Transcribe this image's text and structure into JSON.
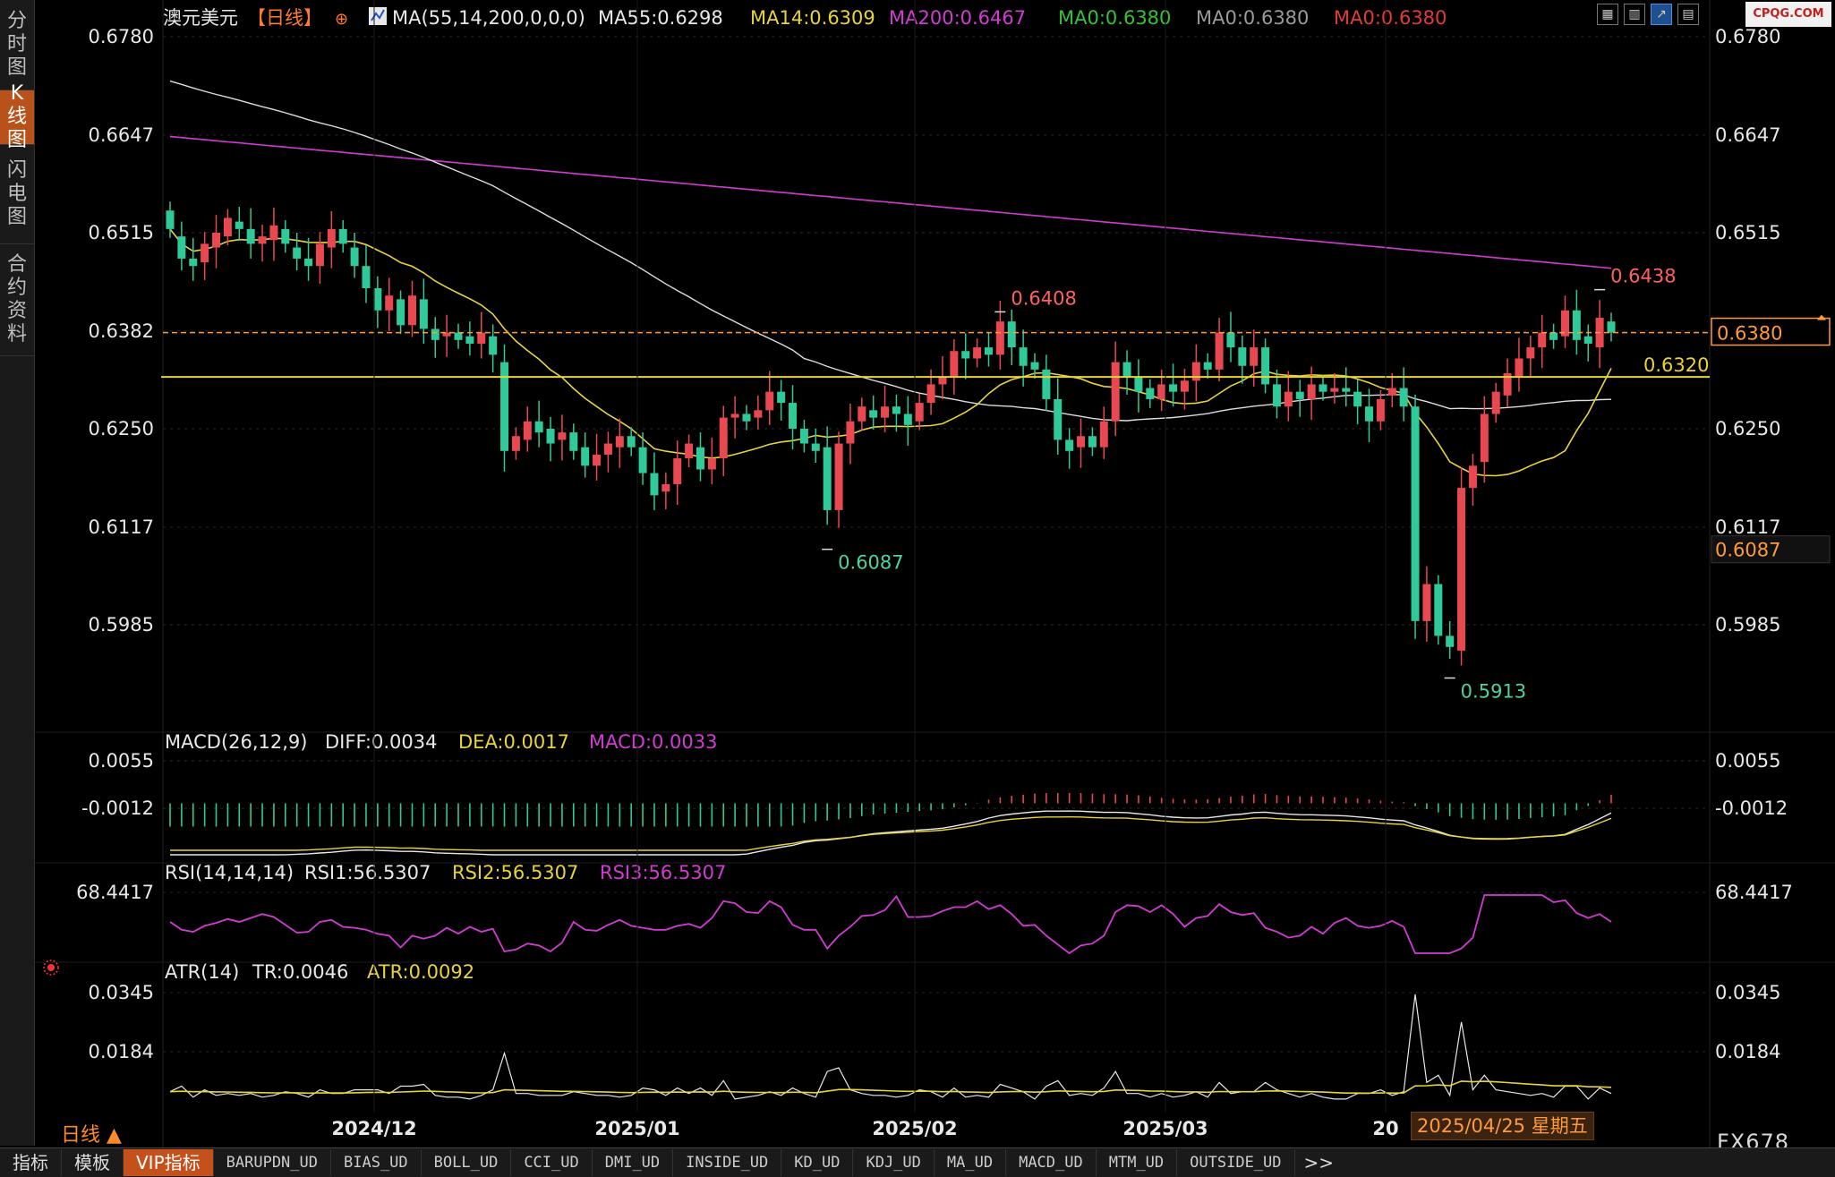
{
  "sidebar": {
    "tabs": [
      {
        "label": [
          "分",
          "时",
          "图"
        ],
        "active": false
      },
      {
        "label": [
          "K",
          "线",
          "图"
        ],
        "active": true
      },
      {
        "label": [
          "闪",
          "电",
          "图"
        ],
        "active": false
      },
      {
        "label": [
          "合",
          "约",
          "资",
          "料"
        ],
        "active": false
      }
    ]
  },
  "header": {
    "symbol": "澳元美元",
    "period_tag": "【日线】",
    "ma_params": "MA(55,14,200,0,0,0)",
    "ma_values": [
      {
        "text": "MA55:0.6298",
        "color": "#e8e8e8"
      },
      {
        "text": "MA14:0.6309",
        "color": "#e8d43a"
      },
      {
        "text": "MA200:0.6467",
        "color": "#d23bd2"
      },
      {
        "text": "MA0:0.6380",
        "color": "#35c235"
      },
      {
        "text": "MA0:0.6380",
        "color": "#9a9a9a"
      },
      {
        "text": "MA0:0.6380",
        "color": "#e23a3a"
      }
    ]
  },
  "toolbar": {
    "icons": [
      "grid-icon",
      "bar-chart-icon",
      "line-chart-icon",
      "table-icon"
    ]
  },
  "watermark": "CPQG.COM",
  "main_panel": {
    "y_ticks": [
      "0.6780",
      "0.6647",
      "0.6515",
      "0.6382",
      "0.6250",
      "0.6117",
      "0.5985"
    ],
    "current_price": "0.6380",
    "low_price_tag": "0.6087",
    "support_line_label": "0.6320",
    "annotations": {
      "high1": "0.6408",
      "high2": "0.6438",
      "low1": "0.6087",
      "low2": "0.5913"
    }
  },
  "macd_panel": {
    "params": "MACD(26,12,9)",
    "diff": "DIFF:0.0034",
    "dea": "DEA:0.0017",
    "macd": "MACD:0.0033",
    "y_ticks": [
      "0.0055",
      "-0.0012"
    ]
  },
  "rsi_panel": {
    "params": "RSI(14,14,14)",
    "rsi1": "RSI1:56.5307",
    "rsi2": "RSI2:56.5307",
    "rsi3": "RSI3:56.5307",
    "y_ticks": [
      "68.4417"
    ]
  },
  "atr_panel": {
    "params": "ATR(14)",
    "tr": "TR:0.0046",
    "atr": "ATR:0.0092",
    "y_ticks": [
      "0.0345",
      "0.0184"
    ]
  },
  "x_axis": {
    "labels": [
      "2024/12",
      "2025/01",
      "2025/02",
      "2025/03",
      "20"
    ]
  },
  "period_label": "日线 ▲",
  "date_tooltip": "2025/04/25 星期五",
  "brand": "FX678",
  "bottom_tabs": {
    "main": [
      "指标",
      "模板",
      "VIP指标"
    ],
    "indicators": [
      "BARUPDN_UD",
      "BIAS_UD",
      "BOLL_UD",
      "CCI_UD",
      "DMI_UD",
      "INSIDE_UD",
      "KD_UD",
      "KDJ_UD",
      "MA_UD",
      "MACD_UD",
      "MTM_UD",
      "OUTSIDE_UD"
    ],
    "more": ">>"
  },
  "chart_data": {
    "type": "candlestick",
    "symbol": "澳元美元",
    "period": "日线",
    "x_range": [
      "2024-11-11",
      "2025-04-25"
    ],
    "y_range": [
      0.5913,
      0.678
    ],
    "last_close": 0.638,
    "marked_high": [
      0.6408,
      0.6438
    ],
    "marked_low": [
      0.6087,
      0.5913
    ],
    "support_level": 0.632,
    "moving_averages": {
      "MA55": 0.6298,
      "MA14": 0.6309,
      "MA200": 0.6467
    },
    "candles_approx": [
      [
        0.6545,
        0.652
      ],
      [
        0.651,
        0.648
      ],
      [
        0.648,
        0.647
      ],
      [
        0.6475,
        0.65
      ],
      [
        0.6495,
        0.6515
      ],
      [
        0.651,
        0.6535
      ],
      [
        0.653,
        0.652
      ],
      [
        0.652,
        0.65
      ],
      [
        0.65,
        0.651
      ],
      [
        0.6505,
        0.6525
      ],
      [
        0.652,
        0.65
      ],
      [
        0.6495,
        0.648
      ],
      [
        0.648,
        0.647
      ],
      [
        0.647,
        0.65
      ],
      [
        0.6495,
        0.652
      ],
      [
        0.652,
        0.65
      ],
      [
        0.6495,
        0.647
      ],
      [
        0.647,
        0.644
      ],
      [
        0.644,
        0.641
      ],
      [
        0.641,
        0.643
      ],
      [
        0.6425,
        0.639
      ],
      [
        0.639,
        0.643
      ],
      [
        0.6425,
        0.6385
      ],
      [
        0.6385,
        0.637
      ],
      [
        0.6375,
        0.638
      ],
      [
        0.638,
        0.637
      ],
      [
        0.6375,
        0.6365
      ],
      [
        0.6365,
        0.638
      ],
      [
        0.6375,
        0.635
      ],
      [
        0.634,
        0.622
      ],
      [
        0.622,
        0.624
      ],
      [
        0.6235,
        0.626
      ],
      [
        0.626,
        0.6245
      ],
      [
        0.625,
        0.623
      ],
      [
        0.6235,
        0.6245
      ],
      [
        0.6245,
        0.622
      ],
      [
        0.6225,
        0.62
      ],
      [
        0.62,
        0.6215
      ],
      [
        0.6215,
        0.623
      ],
      [
        0.6225,
        0.624
      ],
      [
        0.624,
        0.6225
      ],
      [
        0.6225,
        0.619
      ],
      [
        0.619,
        0.616
      ],
      [
        0.6165,
        0.6175
      ],
      [
        0.6175,
        0.621
      ],
      [
        0.621,
        0.623
      ],
      [
        0.6225,
        0.6195
      ],
      [
        0.6195,
        0.621
      ],
      [
        0.621,
        0.6265
      ],
      [
        0.6265,
        0.627
      ],
      [
        0.627,
        0.626
      ],
      [
        0.6265,
        0.6275
      ],
      [
        0.6275,
        0.63
      ],
      [
        0.63,
        0.6285
      ],
      [
        0.6285,
        0.625
      ],
      [
        0.625,
        0.623
      ],
      [
        0.623,
        0.622
      ],
      [
        0.6225,
        0.614
      ],
      [
        0.614,
        0.623
      ],
      [
        0.623,
        0.626
      ],
      [
        0.626,
        0.628
      ],
      [
        0.6275,
        0.6265
      ],
      [
        0.6265,
        0.628
      ],
      [
        0.628,
        0.627
      ],
      [
        0.627,
        0.6255
      ],
      [
        0.626,
        0.6285
      ],
      [
        0.6285,
        0.631
      ],
      [
        0.631,
        0.632
      ],
      [
        0.632,
        0.6355
      ],
      [
        0.6355,
        0.6345
      ],
      [
        0.6345,
        0.636
      ],
      [
        0.636,
        0.635
      ],
      [
        0.635,
        0.6395
      ],
      [
        0.6395,
        0.636
      ],
      [
        0.636,
        0.6335
      ],
      [
        0.634,
        0.633
      ],
      [
        0.633,
        0.629
      ],
      [
        0.629,
        0.6235
      ],
      [
        0.6235,
        0.622
      ],
      [
        0.6225,
        0.624
      ],
      [
        0.624,
        0.6225
      ],
      [
        0.6225,
        0.626
      ],
      [
        0.626,
        0.634
      ],
      [
        0.634,
        0.632
      ],
      [
        0.632,
        0.63
      ],
      [
        0.6305,
        0.629
      ],
      [
        0.629,
        0.631
      ],
      [
        0.631,
        0.63
      ],
      [
        0.63,
        0.6315
      ],
      [
        0.6315,
        0.634
      ],
      [
        0.634,
        0.633
      ],
      [
        0.633,
        0.638
      ],
      [
        0.638,
        0.636
      ],
      [
        0.636,
        0.6335
      ],
      [
        0.6335,
        0.636
      ],
      [
        0.636,
        0.631
      ],
      [
        0.631,
        0.628
      ],
      [
        0.628,
        0.63
      ],
      [
        0.63,
        0.629
      ],
      [
        0.629,
        0.631
      ],
      [
        0.631,
        0.63
      ],
      [
        0.63,
        0.6305
      ],
      [
        0.6305,
        0.63
      ],
      [
        0.63,
        0.628
      ],
      [
        0.628,
        0.626
      ],
      [
        0.626,
        0.629
      ],
      [
        0.6295,
        0.6305
      ],
      [
        0.6305,
        0.628
      ],
      [
        0.628,
        0.599
      ],
      [
        0.599,
        0.604
      ],
      [
        0.604,
        0.597
      ],
      [
        0.597,
        0.5955
      ],
      [
        0.595,
        0.617
      ],
      [
        0.617,
        0.62
      ],
      [
        0.6205,
        0.627
      ],
      [
        0.627,
        0.63
      ],
      [
        0.6295,
        0.6325
      ],
      [
        0.632,
        0.6345
      ],
      [
        0.6345,
        0.636
      ],
      [
        0.636,
        0.638
      ],
      [
        0.638,
        0.637
      ],
      [
        0.6375,
        0.641
      ],
      [
        0.641,
        0.637
      ],
      [
        0.6375,
        0.6365
      ],
      [
        0.636,
        0.64
      ],
      [
        0.6395,
        0.638
      ]
    ]
  }
}
